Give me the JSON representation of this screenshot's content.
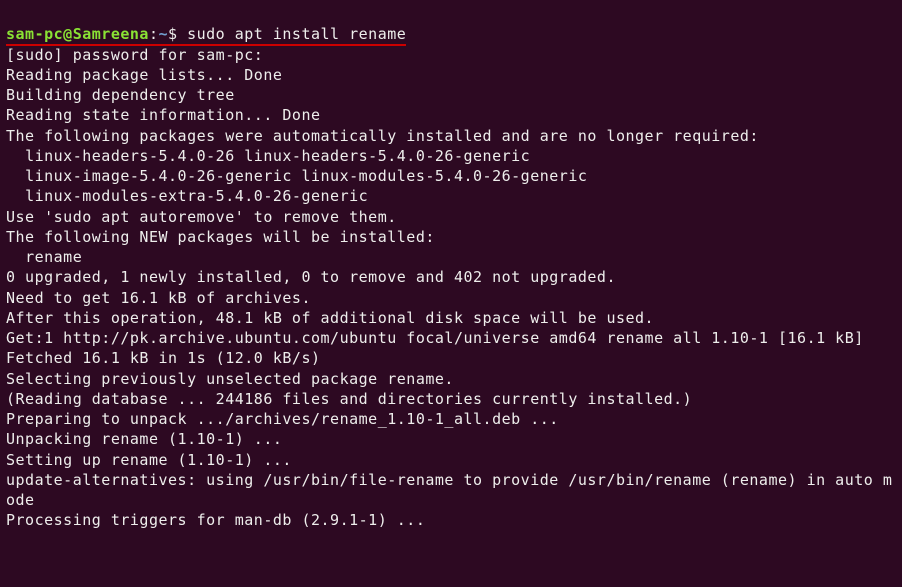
{
  "prompt": {
    "user_host": "sam-pc@Samreena",
    "colon": ":",
    "path": "~",
    "dollar": "$ "
  },
  "command": "sudo apt install rename",
  "output": {
    "l1": "[sudo] password for sam-pc:",
    "l2": "Reading package lists... Done",
    "l3": "Building dependency tree",
    "l4": "Reading state information... Done",
    "l5": "The following packages were automatically installed and are no longer required:",
    "l6": "  linux-headers-5.4.0-26 linux-headers-5.4.0-26-generic",
    "l7": "  linux-image-5.4.0-26-generic linux-modules-5.4.0-26-generic",
    "l8": "  linux-modules-extra-5.4.0-26-generic",
    "l9": "Use 'sudo apt autoremove' to remove them.",
    "l10": "The following NEW packages will be installed:",
    "l11": "  rename",
    "l12": "0 upgraded, 1 newly installed, 0 to remove and 402 not upgraded.",
    "l13": "Need to get 16.1 kB of archives.",
    "l14": "After this operation, 48.1 kB of additional disk space will be used.",
    "l15": "Get:1 http://pk.archive.ubuntu.com/ubuntu focal/universe amd64 rename all 1.10-1 [16.1 kB]",
    "l16": "Fetched 16.1 kB in 1s (12.0 kB/s)",
    "l17": "Selecting previously unselected package rename.",
    "l18": "(Reading database ... 244186 files and directories currently installed.)",
    "l19": "Preparing to unpack .../archives/rename_1.10-1_all.deb ...",
    "l20": "Unpacking rename (1.10-1) ...",
    "l21": "Setting up rename (1.10-1) ...",
    "l22": "update-alternatives: using /usr/bin/file-rename to provide /usr/bin/rename (rename) in auto mode",
    "l23": "Processing triggers for man-db (2.9.1-1) ..."
  }
}
